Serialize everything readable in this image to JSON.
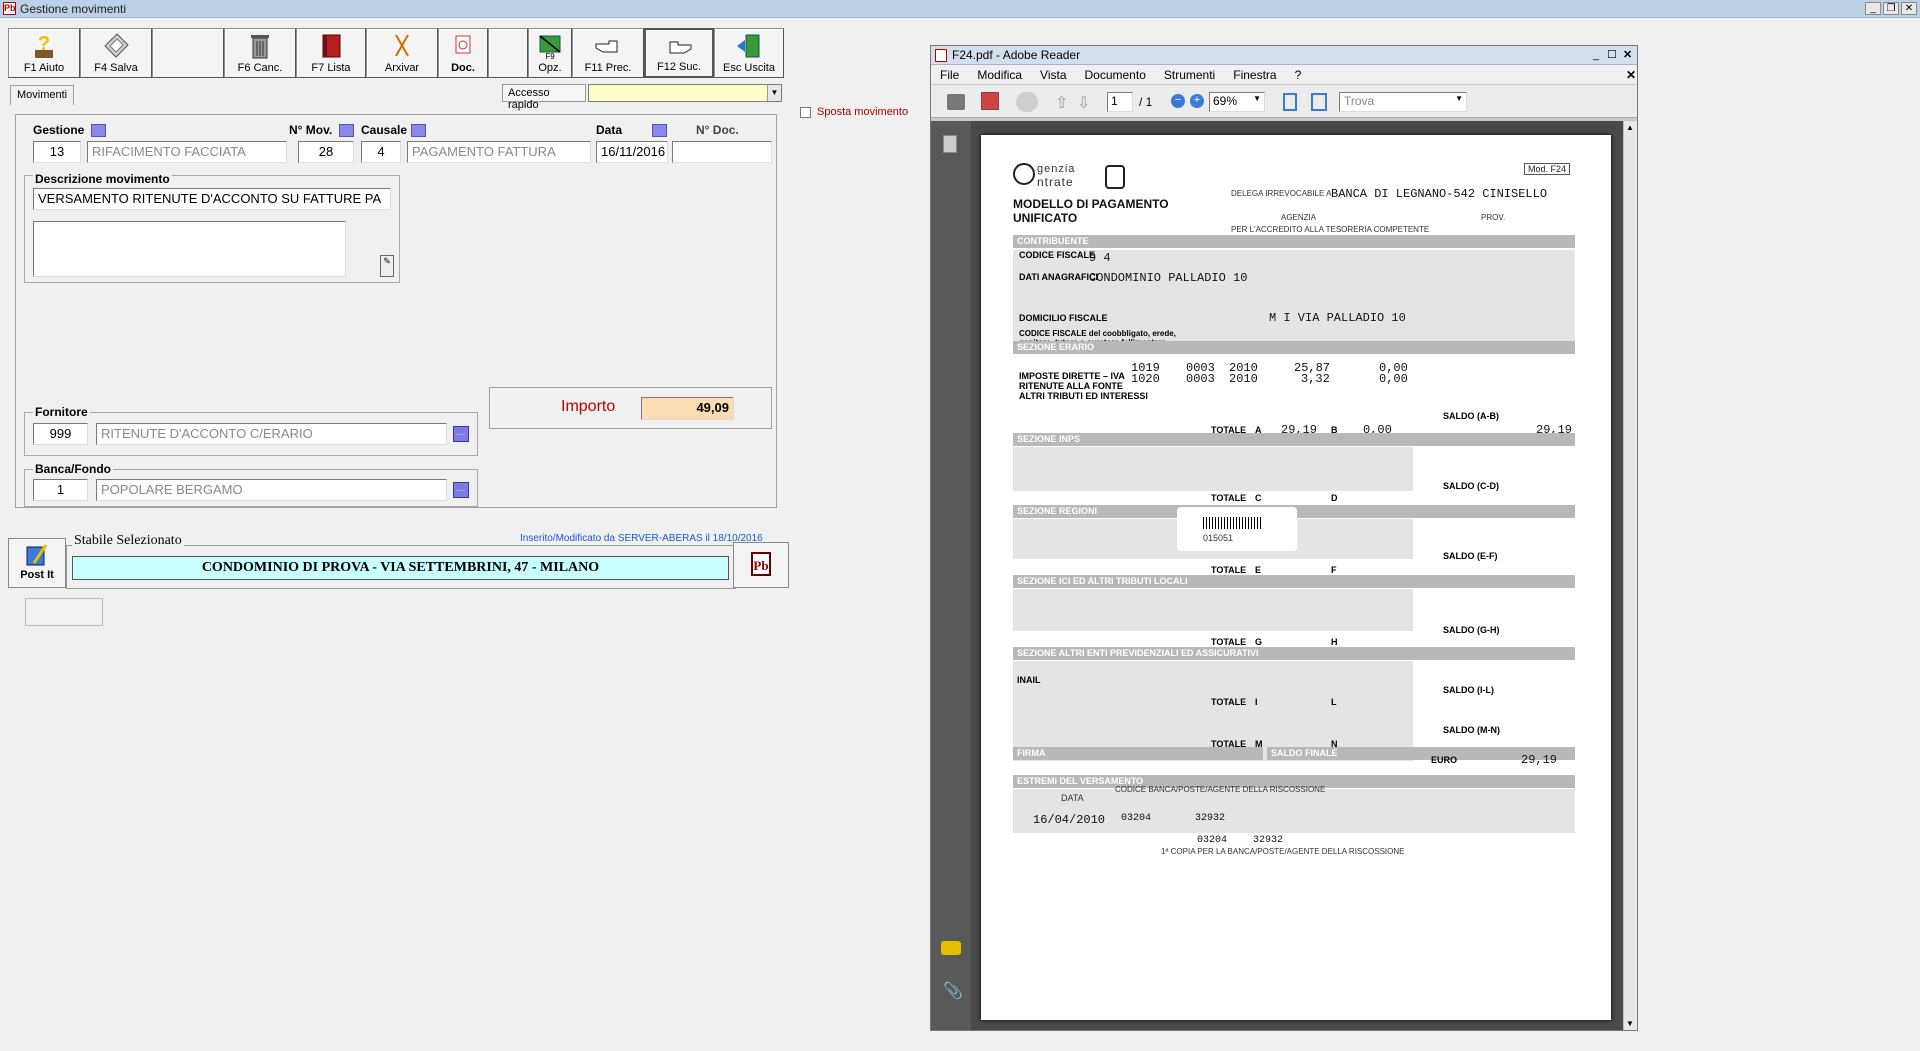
{
  "app": {
    "title": "Gestione movimenti"
  },
  "toolbar": {
    "help": "F1 Aiuto",
    "save": "F4 Salva",
    "cancel": "F6 Canc.",
    "list": "F7 Lista",
    "archive": "Arxivar",
    "doc": "Doc.",
    "opt": "Opz.",
    "prev": "F11 Prec.",
    "next": "F12 Suc.",
    "exit": "Esc Uscita"
  },
  "tab": {
    "label": "Movimenti"
  },
  "quick_access": {
    "label": "Accesso rapido",
    "value": ""
  },
  "move_checkbox": {
    "label": "Sposta movimento"
  },
  "form": {
    "gestione_label": "Gestione",
    "gestione_code": "13",
    "gestione_desc": "RIFACIMENTO FACCIATA",
    "nmov_label": "N° Mov.",
    "nmov_value": "28",
    "causale_label": "Causale",
    "causale_code": "4",
    "causale_desc": "PAGAMENTO FATTURA",
    "data_label": "Data",
    "data_value": "16/11/2016",
    "ndoc_label": "N° Doc.",
    "ndoc_value": "",
    "descr_label": "Descrizione movimento",
    "descr_value": "VERSAMENTO RITENUTE D'ACCONTO SU FATTURE PA",
    "fornitore_label": "Fornitore",
    "fornitore_code": "999",
    "fornitore_desc": "RITENUTE D'ACCONTO C/ERARIO",
    "banca_label": "Banca/Fondo",
    "banca_code": "1",
    "banca_desc": "POPOLARE BERGAMO",
    "importo_label": "Importo",
    "importo_value": "49,09"
  },
  "footer": {
    "postit": "Post It",
    "stabile_label": "Stabile Selezionato",
    "inserted": "Inserito/Modificato da SERVER-ABERAS il 18/10/2016",
    "stabile_value": "CONDOMINIO DI PROVA - VIA SETTEMBRINI, 47 - MILANO"
  },
  "pdf": {
    "title": "F24.pdf - Adobe Reader",
    "menu": [
      "File",
      "Modifica",
      "Vista",
      "Documento",
      "Strumenti",
      "Finestra",
      "?"
    ],
    "page_current": "1",
    "page_total": "/ 1",
    "zoom": "69%",
    "find_placeholder": "Trova"
  },
  "f24": {
    "mod": "Mod. F24",
    "agency_line1": "genzia",
    "agency_line2": "ntrate",
    "heading1": "MODELLO DI PAGAMENTO",
    "heading2": "UNIFICATO",
    "delega": "DELEGA IRREVOCABILE A:",
    "bank": "BANCA DI LEGNANO-542 CINISELLO",
    "agenzia": "AGENZIA",
    "prov": "PROV.",
    "accredito": "PER L'ACCREDITO ALLA TESORERIA COMPETENTE",
    "sec_contribuente": "CONTRIBUENTE",
    "cf_label": "CODICE FISCALE",
    "cf_value": "9 4",
    "anag_label": "DATI ANAGRAFICI",
    "anag_value": "CONDOMINIO PALLADIO 10",
    "dom_label": "DOMICILIO FISCALE",
    "dom_value": "M I  VIA PALLADIO 10",
    "coobl_label": "CODICE FISCALE del coobbligato, erede, genitore, tutore o curatore fallimentare",
    "sec_erario": "SEZIONE ERARIO",
    "imposte": "IMPOSTE DIRETTE – IVA",
    "ritenute": "RITENUTE ALLA FONTE",
    "altri": "ALTRI TRIBUTI ED INTERESSI",
    "rows": [
      {
        "codice": "1019",
        "rateazione": "0003",
        "anno": "2010",
        "debito": "25,87",
        "credito": "0,00"
      },
      {
        "codice": "1020",
        "rateazione": "0003",
        "anno": "2010",
        "debito": "3,32",
        "credito": "0,00"
      }
    ],
    "totale": "TOTALE",
    "tot_a_label": "A",
    "tot_a": "29,19",
    "tot_b_label": "B",
    "tot_b": "0,00",
    "saldo_ab_label": "SALDO (A-B)",
    "saldo_ab": "29,19",
    "sec_inps": "SEZIONE INPS",
    "saldo_cd": "SALDO (C-D)",
    "tot_c_label": "C",
    "tot_d_label": "D",
    "sec_regioni": "SEZIONE REGIONI",
    "barcode_num": "015051",
    "saldo_ef": "SALDO (E-F)",
    "tot_e_label": "E",
    "tot_f_label": "F",
    "sec_ici": "SEZIONE ICI ED ALTRI TRIBUTI LOCALI",
    "saldo_gh": "SALDO (G-H)",
    "tot_g_label": "G",
    "tot_h_label": "H",
    "sec_altri": "SEZIONE ALTRI ENTI PREVIDENZIALI ED ASSICURATIVI",
    "inail": "INAIL",
    "saldo_il": "SALDO (I-L)",
    "tot_i_label": "I",
    "tot_l_label": "L",
    "saldo_mn": "SALDO (M-N)",
    "tot_m_label": "M",
    "tot_n_label": "N",
    "firma": "FIRMA",
    "saldo_finale": "SALDO FINALE",
    "euro": "EURO",
    "euro_value": "29,19",
    "estremi": "ESTREMI DEL VERSAMENTO",
    "data_label": "DATA",
    "data_value": "16/04/2010",
    "abi": "03204",
    "cab": "32932",
    "cod_banca": "CODICE BANCA/POSTE/AGENTE DELLA RISCOSSIONE",
    "abi_bottom": "03204",
    "cab_bottom": "32932",
    "copia": "1ª COPIA PER LA BANCA/POSTE/AGENTE DELLA RISCOSSIONE"
  },
  "colors": {
    "importo_bg": "#fcdcb4",
    "stabile_bg": "#c8ffff",
    "quick_access_bg": "#ffffc8",
    "accent_red": "#c00000"
  }
}
